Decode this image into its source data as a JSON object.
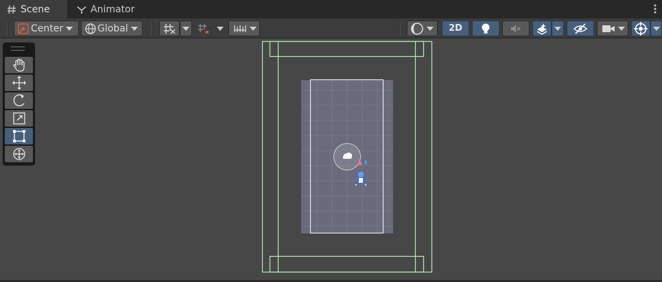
{
  "tabs": {
    "scene": "Scene",
    "animator": "Animator"
  },
  "toolbar": {
    "pivot_mode": "Center",
    "pivot_rotation": "Global",
    "mode_2d": "2D"
  },
  "tools": [
    {
      "name": "hand-tool",
      "icon": "hand-icon",
      "active": false
    },
    {
      "name": "move-tool",
      "icon": "move-icon",
      "active": false
    },
    {
      "name": "rotate-tool",
      "icon": "rotate-icon",
      "active": false
    },
    {
      "name": "scale-tool",
      "icon": "scale-icon",
      "active": false
    },
    {
      "name": "rect-tool",
      "icon": "rect-icon",
      "active": true
    },
    {
      "name": "transform-tool",
      "icon": "transform-icon",
      "active": false
    }
  ],
  "colors": {
    "toolbar_bg": "#3c3c3c",
    "tabbar_bg": "#282828",
    "viewport_bg": "#474747",
    "accent_blue": "#46607c",
    "camera_green": "#b4f0b4",
    "sprite_bg": "#6a6a7c"
  }
}
